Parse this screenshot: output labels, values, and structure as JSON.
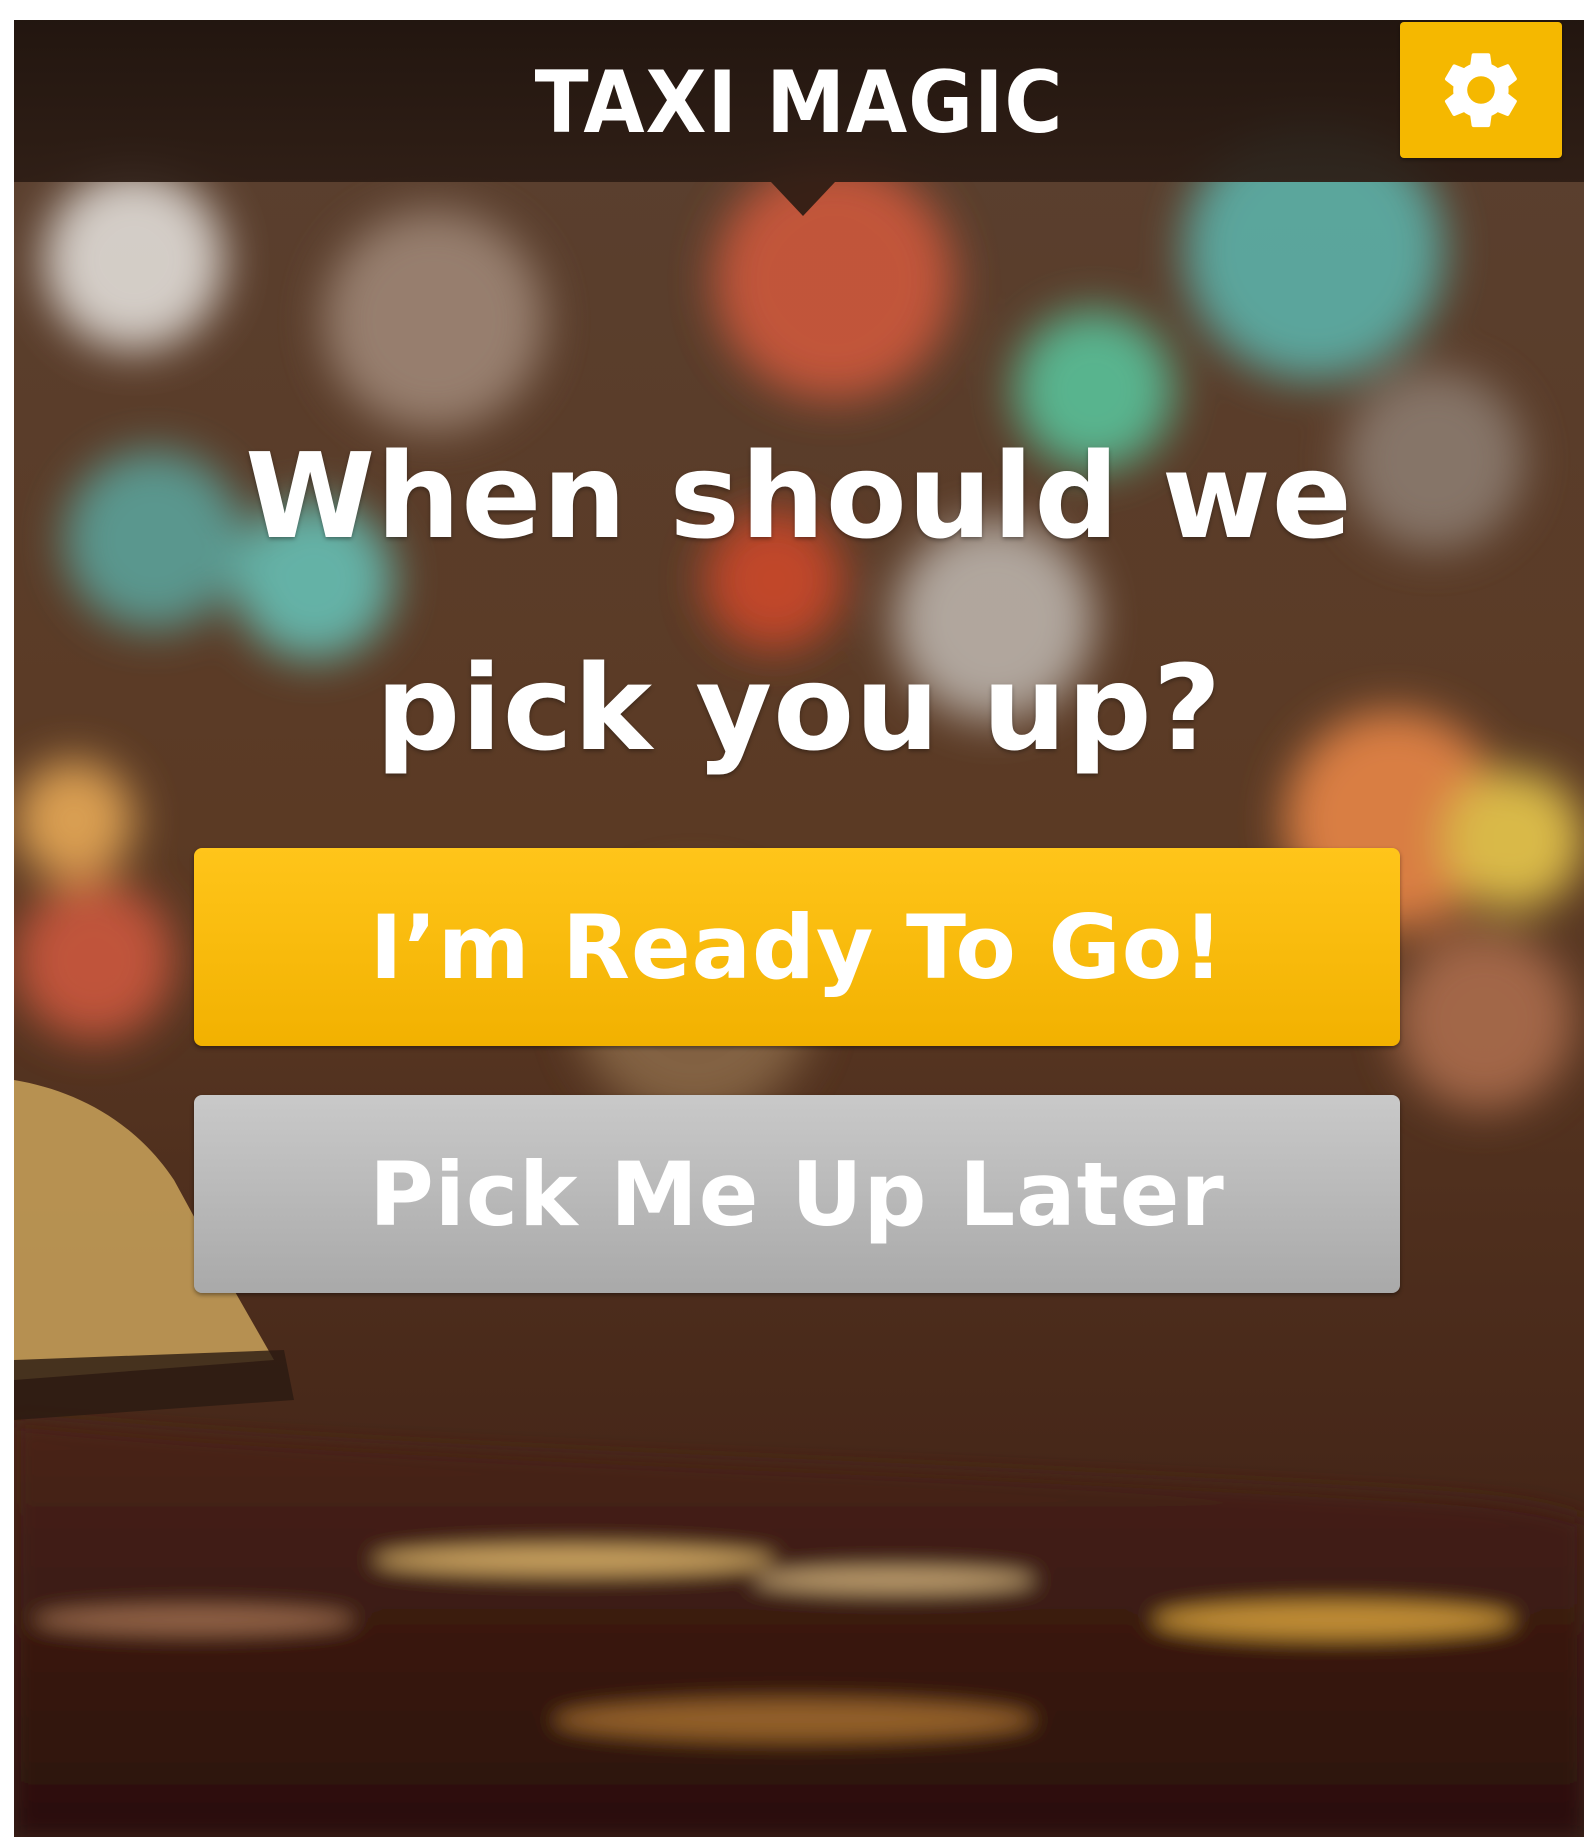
{
  "app": {
    "title": "TAXI MAGIC"
  },
  "header": {
    "settings_icon": "gear-icon"
  },
  "main": {
    "headline_line1": "When should we",
    "headline_line2": "pick you up?",
    "ready_button_label": "I’m Ready To Go!",
    "later_button_label": "Pick Me Up Later"
  },
  "colors": {
    "accent": "#f5b800",
    "secondary_button": "#b5b5b5",
    "text": "#ffffff"
  }
}
